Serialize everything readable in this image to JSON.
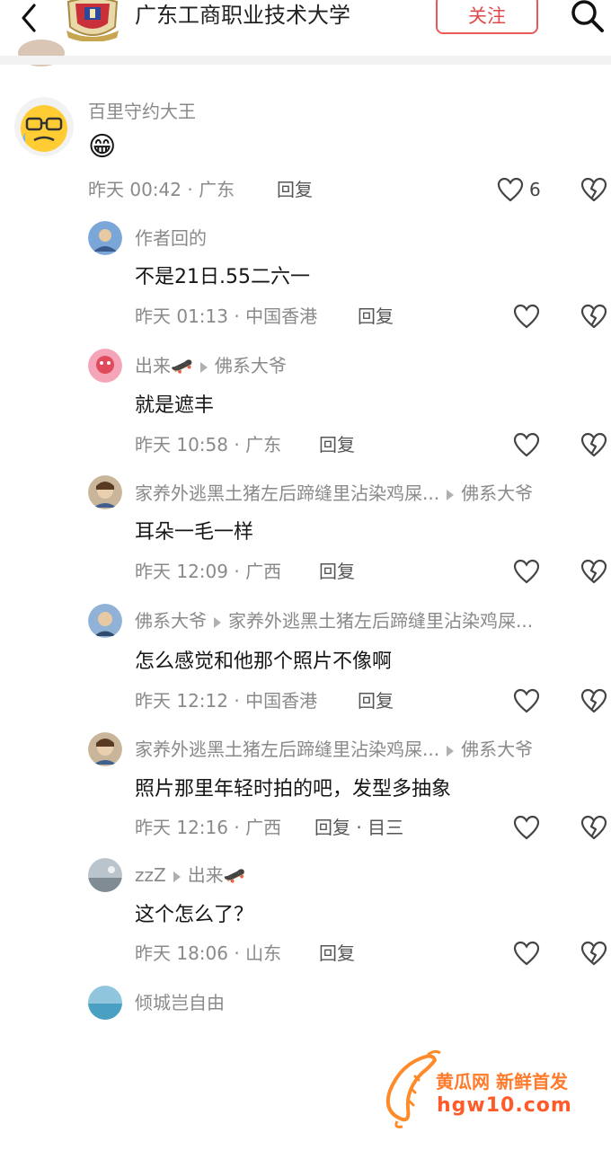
{
  "header": {
    "title": "广东工商职业技术大学",
    "follow_label": "关注"
  },
  "comments": {
    "main": {
      "username": "百里守约大王",
      "emoji": "😁",
      "time": "昨天 00:42 · 广东",
      "reply_label": "回复",
      "likes": "6"
    },
    "replies": [
      {
        "username": "作者回的",
        "content": "不是21日.55二六一",
        "time": "昨天 01:13 · 中国香港",
        "reply_label": "回复"
      },
      {
        "username": "出来🛹",
        "to": "佛系大爷",
        "content": "就是遮丰",
        "time": "昨天 10:58 · 广东",
        "reply_label": "回复"
      },
      {
        "username": "家养外逃黑土猪左后蹄缝里沾染鸡屎...",
        "to": "佛系大爷",
        "content": "耳朵一毛一样",
        "time": "昨天 12:09 · 广西",
        "reply_label": "回复"
      },
      {
        "username": "佛系大爷",
        "to": "家养外逃黑土猪左后蹄缝里沾染鸡屎...",
        "content": "怎么感觉和他那个照片不像啊",
        "time": "昨天 12:12 · 中国香港",
        "reply_label": "回复"
      },
      {
        "username": "家养外逃黑土猪左后蹄缝里沾染鸡屎...",
        "to": "佛系大爷",
        "content": "照片那里年轻时拍的吧，发型多抽象",
        "time": "昨天 12:16 · 广西",
        "reply_label": "回复 · 目三"
      },
      {
        "username": "zzZ",
        "to": "出来🛹",
        "content": "这个怎么了？",
        "time": "昨天 18:06 · 山东",
        "reply_label": "回复"
      },
      {
        "username": "倾城岂自由"
      }
    ]
  },
  "watermark": {
    "line1": "黄瓜网 新鲜首发",
    "line2": "hgw10.com"
  },
  "colors": {
    "accent": "#e24848",
    "meta": "#8a8a8a",
    "watermark": "#ff7a2a"
  }
}
